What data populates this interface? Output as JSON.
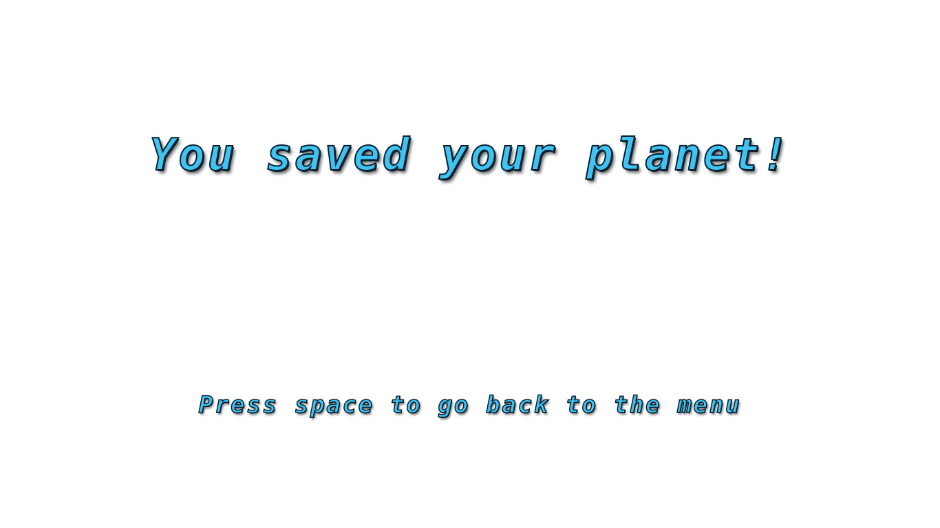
{
  "screen": {
    "title": "You saved your planet!",
    "prompt": "Press space to go back to the menu"
  },
  "colors": {
    "background": "#ffffff",
    "text_fill": "#3ec3f2",
    "text_outline": "#0b1f2c"
  }
}
